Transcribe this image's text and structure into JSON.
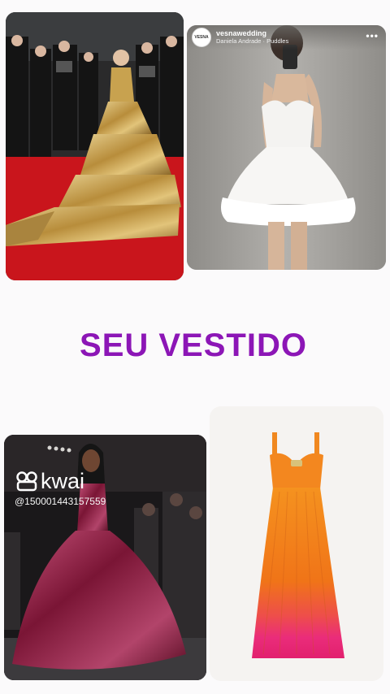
{
  "headline": "SEU VESTIDO",
  "instagram_post": {
    "username": "vesnawedding",
    "audio": "Daniela Andrade · Puddles",
    "avatar_text": "VESNA",
    "more_icon": "more-horizontal-icon"
  },
  "kwai_overlay": {
    "brand": "kwai",
    "user_id": "@150001443157559",
    "logo_icon": "kwai-logo-icon"
  },
  "colors": {
    "headline": "#8c16b6",
    "red_carpet": "#c9151c",
    "gold_gown": "#c9a14e",
    "orange_dress": "#f07a1a",
    "pink_hem": "#ea2c7a",
    "magenta_gown": "#8e1d43"
  }
}
